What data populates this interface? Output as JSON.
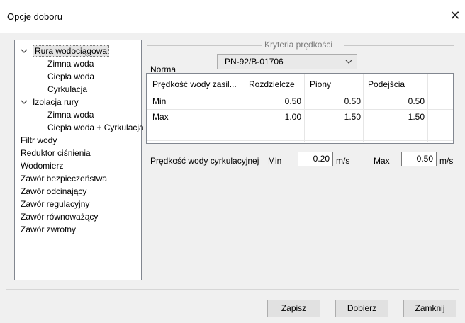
{
  "window": {
    "title": "Opcje doboru"
  },
  "tree": {
    "items": [
      {
        "label": "Rura wodociągowa",
        "expanded": true,
        "selected": true
      },
      {
        "label": "Zimna woda"
      },
      {
        "label": "Ciepła woda"
      },
      {
        "label": "Cyrkulacja"
      },
      {
        "label": "Izolacja rury",
        "expanded": true
      },
      {
        "label": "Zimna woda"
      },
      {
        "label": "Ciepła woda + Cyrkulacja"
      },
      {
        "label": "Filtr wody"
      },
      {
        "label": "Reduktor ciśnienia"
      },
      {
        "label": "Wodomierz"
      },
      {
        "label": "Zawór bezpieczeństwa"
      },
      {
        "label": "Zawór odcinający"
      },
      {
        "label": "Zawór regulacyjny"
      },
      {
        "label": "Zawór równoważący"
      },
      {
        "label": "Zawór zwrotny"
      }
    ]
  },
  "criteria": {
    "legend": "Kryteria prędkości",
    "norma_label": "Norma",
    "norma_value": "PN-92/B-01706",
    "columns": [
      "Prędkość wody zasil...",
      "Rozdzielcze",
      "Piony",
      "Podejścia"
    ],
    "rows": [
      [
        "Min",
        "0.50",
        "0.50",
        "0.50"
      ],
      [
        "Max",
        "1.00",
        "1.50",
        "1.50"
      ]
    ]
  },
  "circulation": {
    "label": "Prędkość wody cyrkulacyjnej",
    "min_label": "Min",
    "min_value": "0.20",
    "max_label": "Max",
    "max_value": "0.50",
    "unit": "m/s"
  },
  "buttons": {
    "save": "Zapisz",
    "select": "Dobierz",
    "close": "Zamknij"
  }
}
